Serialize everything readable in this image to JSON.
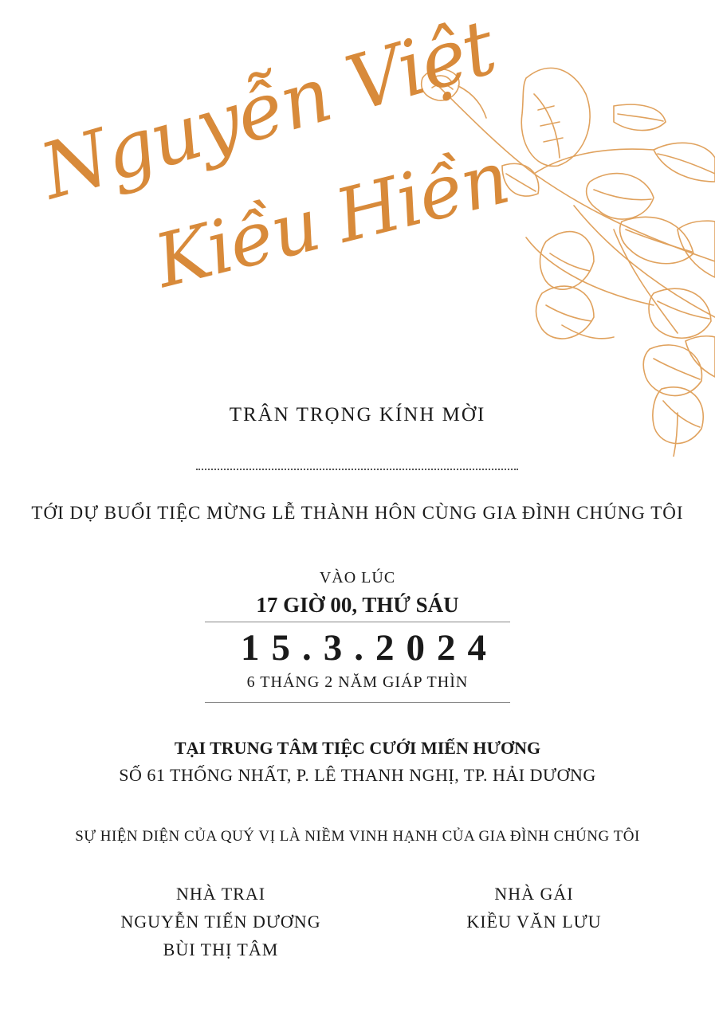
{
  "couple": {
    "groom": "Nguyễn Việt",
    "bride": "Kiều Hiền"
  },
  "invitation": {
    "greeting": "TRÂN TRỌNG KÍNH MỜI",
    "attend": "TỚI DỰ BUỔI TIỆC MỪNG LỄ THÀNH HÔN CÙNG GIA ĐÌNH CHÚNG TÔI"
  },
  "event": {
    "at_label": "VÀO LÚC",
    "time": "17 GIỜ 00, THỨ SÁU",
    "date": "15.3.2024",
    "lunar": "6 THÁNG 2 NĂM GIÁP THÌN",
    "venue": "TẠI TRUNG TÂM TIỆC CƯỚI MIẾN HƯƠNG",
    "address": "SỐ 61 THỐNG NHẤT, P. LÊ THANH NGHỊ, TP. HẢI DƯƠNG"
  },
  "honor": "SỰ HIỆN DIỆN CỦA QUÝ VỊ LÀ NIỀM VINH HẠNH CỦA GIA ĐÌNH CHÚNG TÔI",
  "families": {
    "groom_side": {
      "label": "NHÀ TRAI",
      "parents": [
        "NGUYỄN TIẾN DƯƠNG",
        "BÙI THỊ TÂM"
      ]
    },
    "bride_side": {
      "label": "NHÀ GÁI",
      "parents": [
        "KIỀU VĂN LƯU"
      ]
    }
  },
  "colors": {
    "accent": "#d88a3a",
    "text": "#1a1a1a",
    "rule": "#888888"
  },
  "icons": {
    "decoration": "floral-branch-illustration"
  }
}
